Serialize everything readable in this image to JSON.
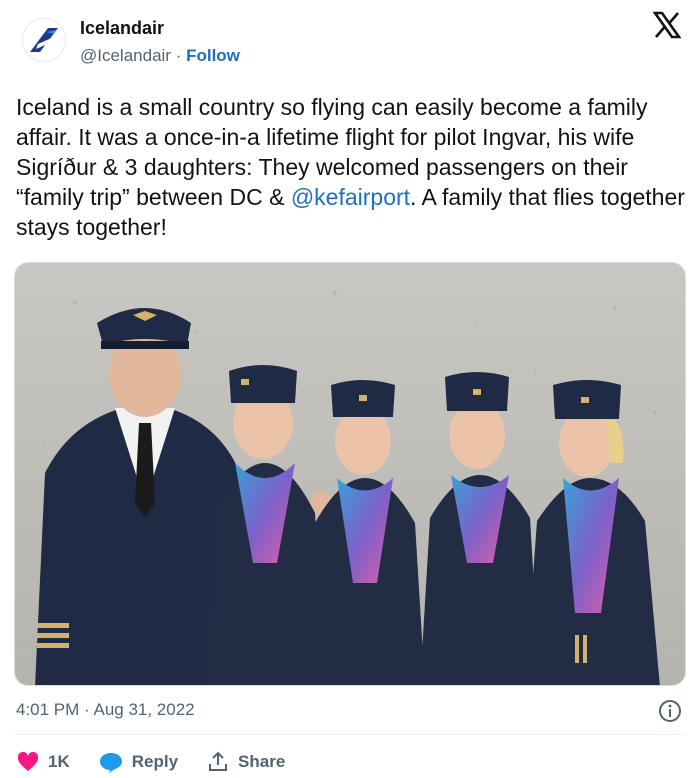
{
  "account": {
    "name": "Icelandair",
    "handle": "@Icelandair",
    "separator": " · ",
    "follow_label": "Follow"
  },
  "tweet": {
    "text_before_mention": "Iceland is a small country so flying can easily become a family affair. It was a once-in-a lifetime flight for pilot Ingvar, his wife Sigríður & 3 daughters: They welcomed passengers on their “family trip” between DC & ",
    "mention": "@kefairport",
    "text_after_mention": ". A family that flies together stays together!",
    "timestamp": "4:01 PM · Aug 31, 2022"
  },
  "actions": {
    "like_count": "1K",
    "reply_label": "Reply",
    "share_label": "Share"
  },
  "icons": {
    "logo": "icelandair-logo-icon",
    "platform": "x-logo-icon",
    "info": "info-icon",
    "like": "heart-icon",
    "reply": "reply-bubble-icon",
    "share": "share-icon"
  },
  "colors": {
    "link": "#1d6fc4",
    "like": "#f91880",
    "reply": "#1d9bf0",
    "brand": "#1e3a8a",
    "muted": "#536471"
  }
}
